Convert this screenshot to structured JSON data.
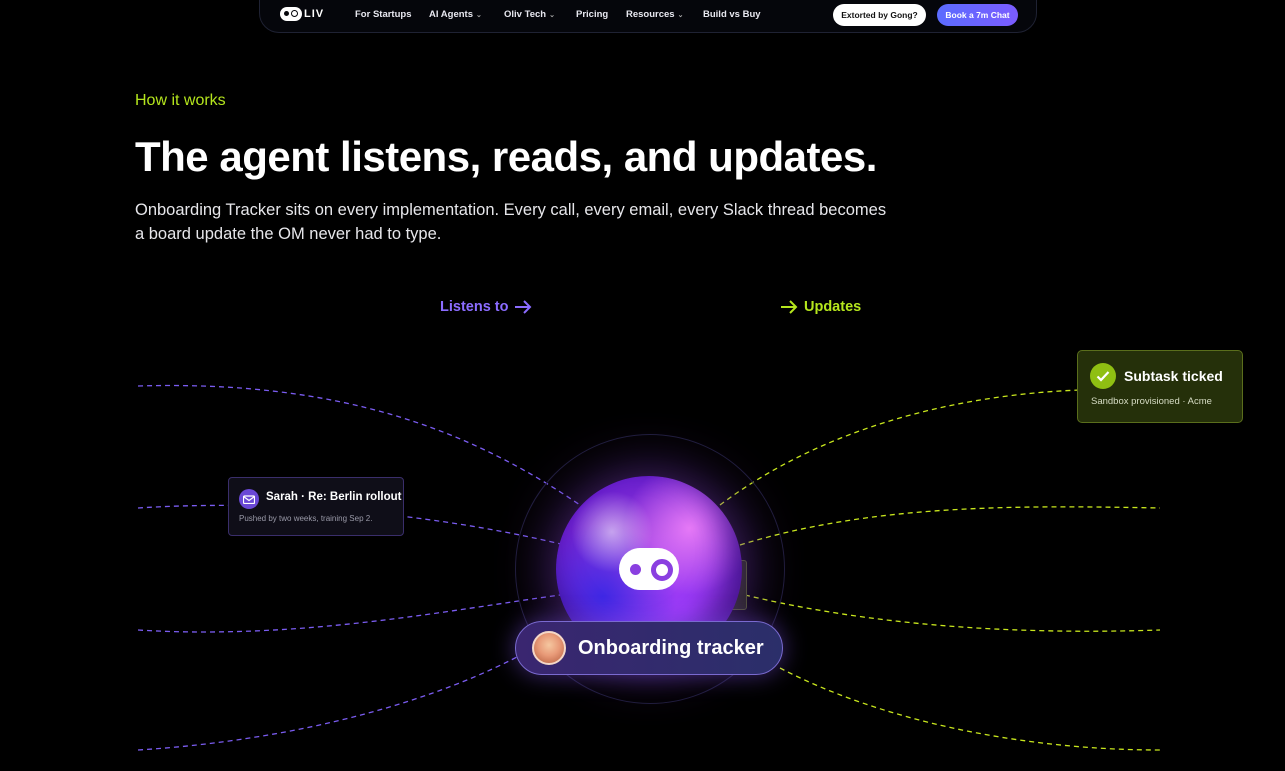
{
  "nav": {
    "logo_text": "LIV",
    "items": [
      {
        "label": "For Startups"
      },
      {
        "label": "AI Agents"
      },
      {
        "label": "Oliv Tech"
      },
      {
        "label": "Pricing"
      },
      {
        "label": "Resources"
      },
      {
        "label": "Build vs Buy"
      }
    ],
    "gong_button": "Extorted by Gong?",
    "chat_button": "Book a 7m Chat"
  },
  "hero": {
    "eyebrow": "How it works",
    "headline": "The agent listens, reads, and updates.",
    "subhead": "Onboarding Tracker sits on every implementation. Every call, every email, every Slack thread becomes a board update the OM never had to type."
  },
  "diagram": {
    "listens_label": "Listens to",
    "updates_label": "Updates",
    "sarah_card": {
      "title": "Sarah · Re: Berlin rollout",
      "meta": "Pushed by two weeks, training Sep 2.",
      "icon": "mail-icon"
    },
    "subtask_card": {
      "title": "Subtask ticked",
      "meta": "Sandbox provisioned · Acme",
      "icon": "check-icon"
    },
    "agent": {
      "label": "Onboarding tracker"
    },
    "colors": {
      "inputs": "#8b6cff",
      "outputs": "#c8e61d",
      "accent": "#b5e61d"
    }
  }
}
